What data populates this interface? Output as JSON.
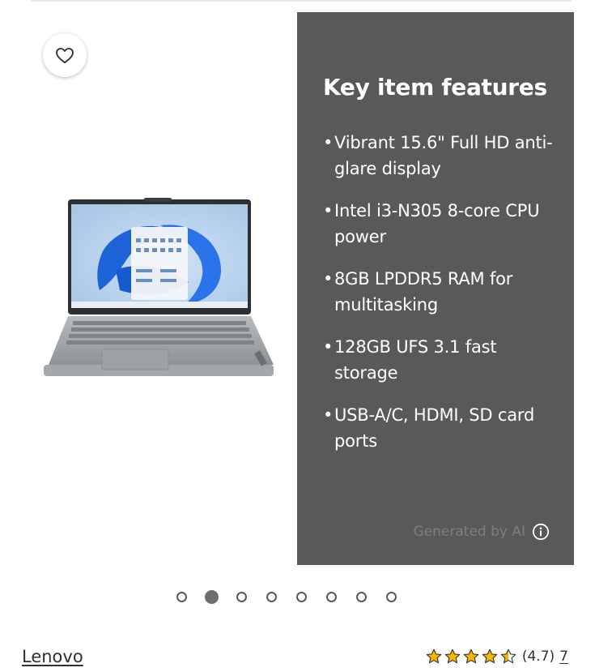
{
  "features": {
    "title": "Key item features",
    "items": [
      "Vibrant 15.6\" Full HD anti-glare display",
      "Intel i3-N305 8-core CPU power",
      "8GB LPDDR5 RAM for multitasking",
      "128GB UFS 3.1 fast storage",
      "USB-A/C, HDMI, SD card ports"
    ],
    "bullet": "•",
    "ai_note": "Generated by AI",
    "info_icon": "info-icon"
  },
  "favorite": {
    "icon": "heart-icon"
  },
  "carousel": {
    "total": 8,
    "active_index": 1
  },
  "product": {
    "brand": "Lenovo",
    "image": "laptop-product-image"
  },
  "rating": {
    "value_label": "(4.7)",
    "stars": 4.5,
    "count": "7"
  },
  "colors": {
    "panel_bg": "#58595b",
    "star": "#f5b400",
    "dot": "#58595b"
  }
}
